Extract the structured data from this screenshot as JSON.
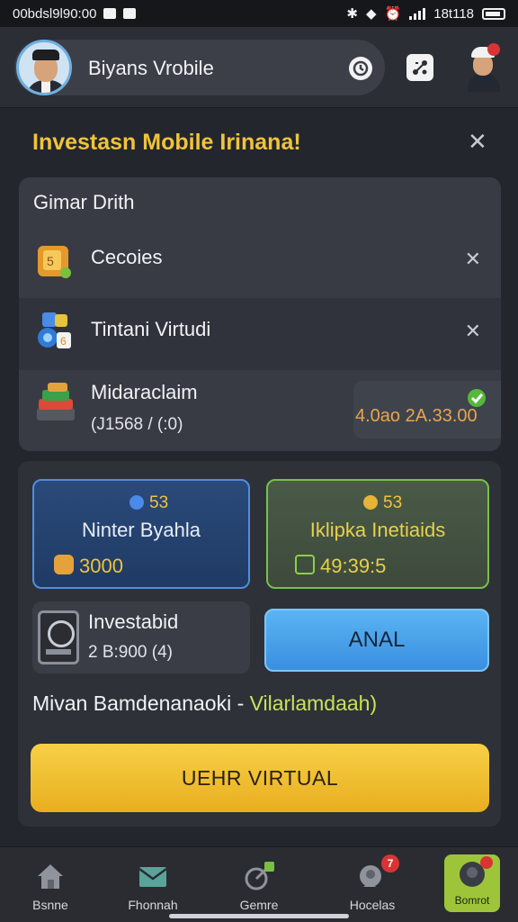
{
  "status_bar": {
    "left_text": "00bdsl9l90:00",
    "right_text": "18t118"
  },
  "header": {
    "title": "Biyans Vrobile",
    "notification_count": ""
  },
  "panel": {
    "title": "Investasn Mobile Irinana!"
  },
  "list": {
    "heading": "Gimar Drith",
    "items": [
      {
        "label": "Cecoies"
      },
      {
        "label": "Tintani Virtudi"
      },
      {
        "label": "Midaraclaim",
        "sub": "(J1568 / (:0)",
        "value": "4.0ao 2A.33.00"
      }
    ]
  },
  "cards": {
    "blue": {
      "top": "53",
      "title": "Ninter Byahla",
      "amount": "3000"
    },
    "green": {
      "top": "53",
      "title": "Iklipka Inetiaids",
      "amount": "49:39:5"
    }
  },
  "mini": {
    "title": "Investabid",
    "sub": "2 B:900 (4)"
  },
  "anal_button": "ANAL",
  "tagline": {
    "main": "Mivan Bamdenanaoki - ",
    "highlight": "Vilarlamdaah)"
  },
  "cta": "UEHR VIRTUAL",
  "nav": [
    {
      "label": "Bsnne",
      "icon": "home-icon"
    },
    {
      "label": "Fhonnah",
      "icon": "mail-icon"
    },
    {
      "label": "Gemre",
      "icon": "game-icon"
    },
    {
      "label": "Hocelas",
      "icon": "chat-icon",
      "badge": "7"
    },
    {
      "label": "Bomrot",
      "icon": "profile-icon"
    }
  ],
  "colors": {
    "accent_gold": "#f0c33a",
    "blue_card": "#2b4a7a",
    "green_card": "#4a5a47",
    "cta": "#f7d046",
    "badge": "#d93434"
  }
}
